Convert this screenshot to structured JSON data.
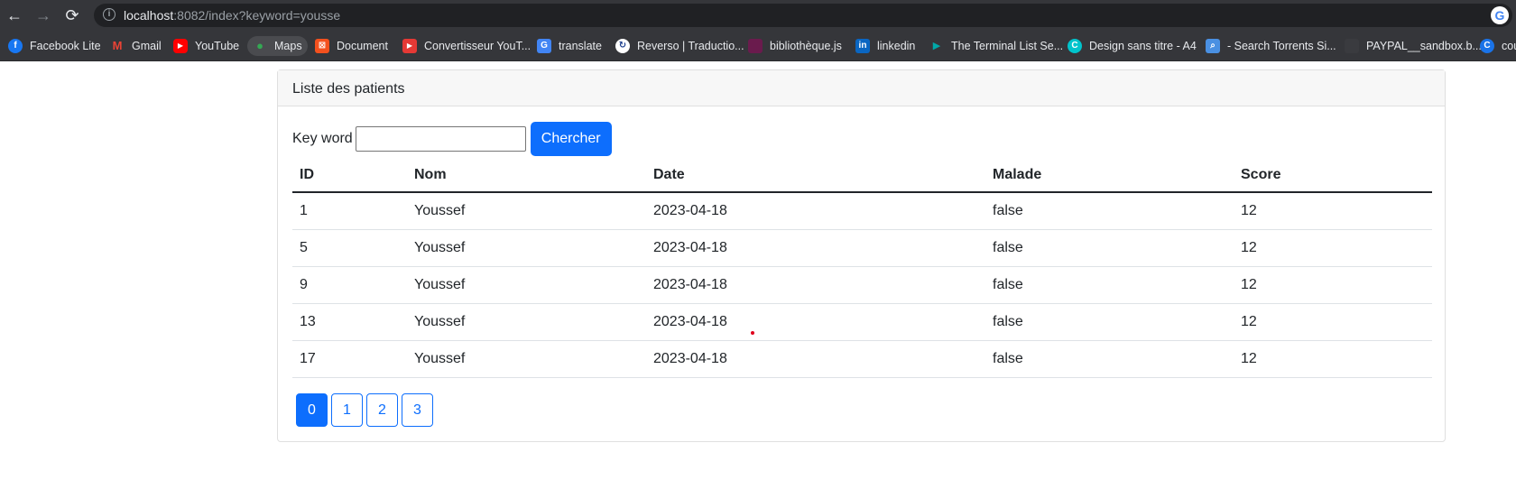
{
  "browser": {
    "url_host": "localhost",
    "url_rest": ":8082/index?keyword=yousse",
    "bookmarks": [
      {
        "label": "Facebook Lite",
        "icon": "facebook-icon",
        "color": "#1877f2"
      },
      {
        "label": "Gmail",
        "icon": "gmail-icon",
        "color": "#ea4335"
      },
      {
        "label": "YouTube",
        "icon": "youtube-icon",
        "color": "#ff0000"
      },
      {
        "label": "Maps",
        "icon": "maps-icon",
        "color": "#34a853"
      },
      {
        "label": "Document",
        "icon": "document-icon",
        "color": "#f4511e"
      },
      {
        "label": "Convertisseur YouT...",
        "icon": "converter-icon",
        "color": "#e53935"
      },
      {
        "label": "translate",
        "icon": "translate-icon",
        "color": "#4285f4"
      },
      {
        "label": "Reverso | Traductio...",
        "icon": "reverso-icon",
        "color": "#ffffff"
      },
      {
        "label": "bibliothèque.js",
        "icon": "library-icon",
        "color": "#6a1b4d"
      },
      {
        "label": "linkedin",
        "icon": "linkedin-icon",
        "color": "#0a66c2"
      },
      {
        "label": "The Terminal List Se...",
        "icon": "play-icon",
        "color": "#00a8a8"
      },
      {
        "label": "Design sans titre - A4",
        "icon": "canva-icon",
        "color": "#00c4cc"
      },
      {
        "label": "- Search Torrents Si...",
        "icon": "search-torrents-icon",
        "color": "#4a90e2"
      },
      {
        "label": "PAYPAL__sandbox.b...",
        "icon": "paypal-icon",
        "color": "#3a3b3f"
      },
      {
        "label": "cou",
        "icon": "c-icon",
        "color": "#1a73e8"
      }
    ]
  },
  "card": {
    "title": "Liste des patients",
    "search_label": "Key word",
    "search_value": "",
    "search_button": "Chercher"
  },
  "table": {
    "headers": [
      "ID",
      "Nom",
      "Date",
      "Malade",
      "Score"
    ],
    "rows": [
      [
        "1",
        "Youssef",
        "2023-04-18",
        "false",
        "12"
      ],
      [
        "5",
        "Youssef",
        "2023-04-18",
        "false",
        "12"
      ],
      [
        "9",
        "Youssef",
        "2023-04-18",
        "false",
        "12"
      ],
      [
        "13",
        "Youssef",
        "2023-04-18",
        "false",
        "12"
      ],
      [
        "17",
        "Youssef",
        "2023-04-18",
        "false",
        "12"
      ]
    ]
  },
  "pagination": {
    "pages": [
      "0",
      "1",
      "2",
      "3"
    ],
    "active_page": "0"
  },
  "colors": {
    "primary": "#0d6efd",
    "chrome_bg": "#35363a"
  }
}
